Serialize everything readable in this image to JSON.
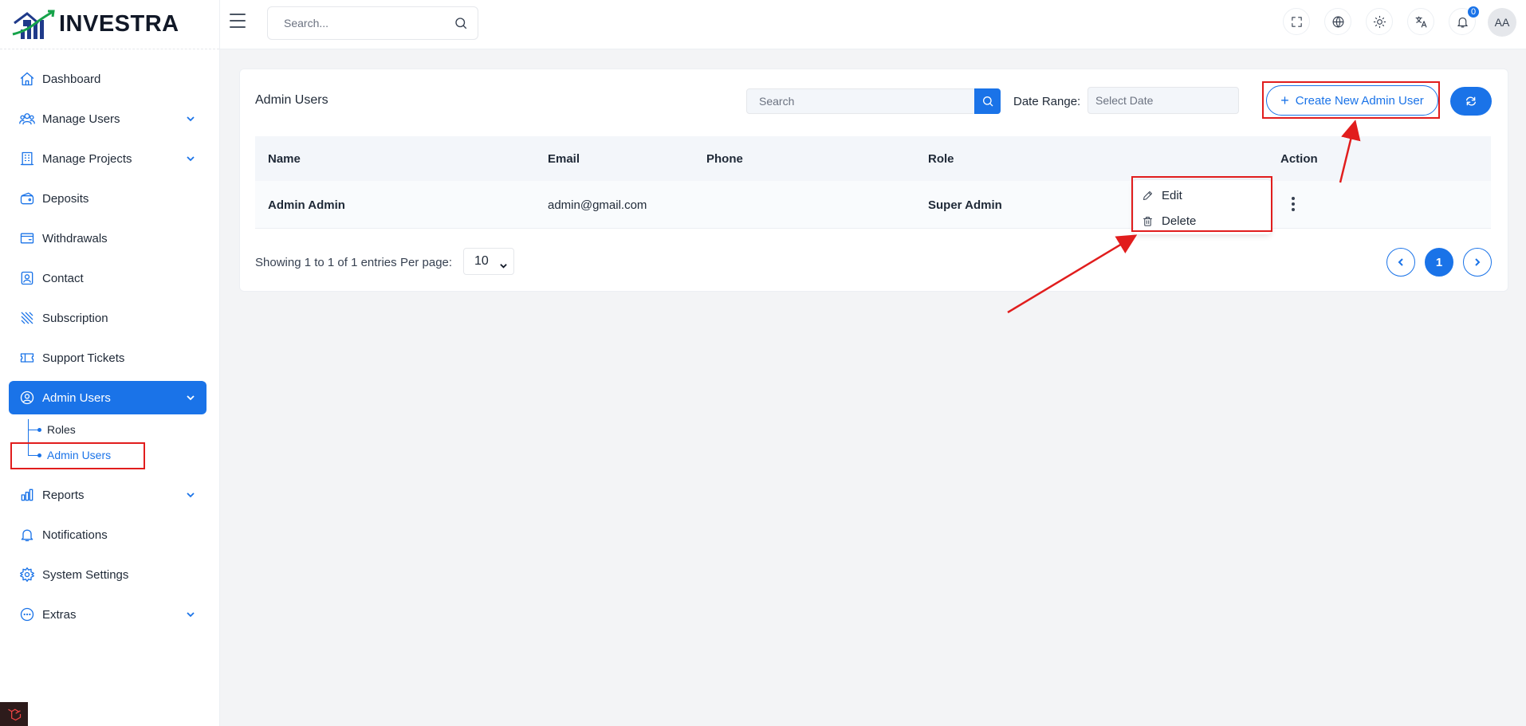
{
  "brand": {
    "name": "INVESTRA"
  },
  "topbar": {
    "search_placeholder": "Search...",
    "notification_count": "0",
    "avatar_initials": "AA"
  },
  "sidebar": {
    "items": [
      {
        "label": "Dashboard",
        "icon": "home-icon"
      },
      {
        "label": "Manage Users",
        "icon": "users-icon",
        "has_children": true
      },
      {
        "label": "Manage Projects",
        "icon": "building-icon",
        "has_children": true
      },
      {
        "label": "Deposits",
        "icon": "wallet-icon"
      },
      {
        "label": "Withdrawals",
        "icon": "withdraw-icon"
      },
      {
        "label": "Contact",
        "icon": "contact-icon"
      },
      {
        "label": "Subscription",
        "icon": "subscription-icon"
      },
      {
        "label": "Support Tickets",
        "icon": "ticket-icon"
      },
      {
        "label": "Admin Users",
        "icon": "user-cog-icon",
        "has_children": true,
        "active": true
      },
      {
        "label": "Reports",
        "icon": "chart-icon",
        "has_children": true
      },
      {
        "label": "Notifications",
        "icon": "bell-icon"
      },
      {
        "label": "System Settings",
        "icon": "gear-icon"
      },
      {
        "label": "Extras",
        "icon": "dots-circle-icon",
        "has_children": true
      }
    ],
    "admin_users_children": [
      {
        "label": "Roles"
      },
      {
        "label": "Admin Users",
        "current": true
      }
    ]
  },
  "card": {
    "title": "Admin Users",
    "search_placeholder": "Search",
    "date_range_label": "Date Range:",
    "date_placeholder": "Select Date",
    "create_button": "Create New Admin User"
  },
  "table": {
    "columns": [
      "Name",
      "Email",
      "Phone",
      "Role",
      "Action"
    ],
    "rows": [
      {
        "name": "Admin Admin",
        "email": "admin@gmail.com",
        "phone": "",
        "role": "Super Admin"
      }
    ]
  },
  "action_menu": {
    "edit": "Edit",
    "delete": "Delete"
  },
  "footer": {
    "showing": "Showing 1 to 1 of 1 entries",
    "per_page_label": "Per page:",
    "per_page_value": "10",
    "current_page": "1"
  },
  "colors": {
    "accent": "#1a73e8",
    "highlight": "#e11d1d"
  }
}
